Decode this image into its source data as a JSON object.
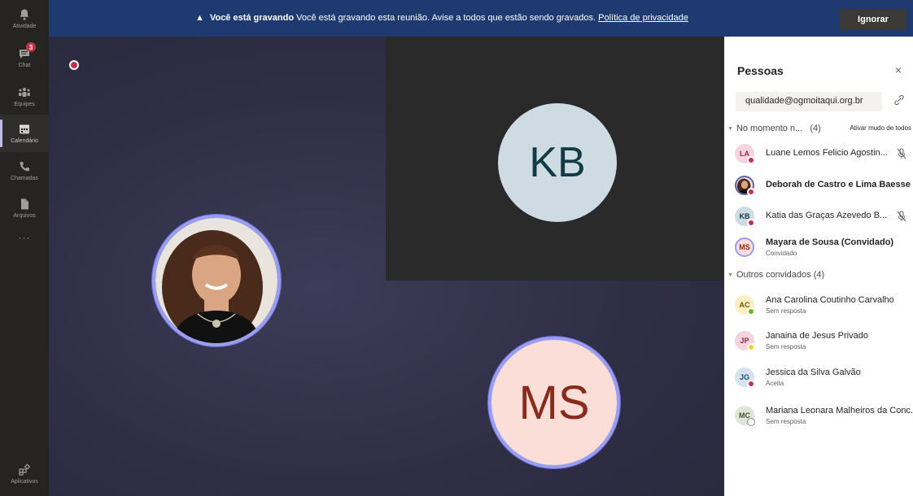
{
  "rail": {
    "items": [
      {
        "label": "Atividade",
        "icon": "bell-icon"
      },
      {
        "label": "Chat",
        "icon": "chat-icon",
        "badge": "3"
      },
      {
        "label": "Equipes",
        "icon": "teams-icon"
      },
      {
        "label": "Calendário",
        "icon": "calendar-icon",
        "active": true
      },
      {
        "label": "Chamadas",
        "icon": "phone-icon"
      },
      {
        "label": "Arquivos",
        "icon": "file-icon"
      },
      {
        "label": "···",
        "icon": "more-icon"
      }
    ],
    "apps_label": "Aplicativos"
  },
  "banner": {
    "title": "Você está gravando",
    "message": "Você está gravando esta reunião. Avise a todos que estão sendo gravados.",
    "link": "Política de privacidade",
    "ignore_label": "Ignorar",
    "color": "#1f3a71"
  },
  "stage": {
    "kb_initials": "KB",
    "ms_initials": "MS"
  },
  "panel": {
    "title": "Pessoas",
    "close": "×",
    "email": "qualidade@ogmoitaqui.org.br",
    "section_current": "No momento n...",
    "section_current_count": "(4)",
    "mute_all": "Ativar mudo de todos",
    "section_others": "Outros convidados (4)",
    "current": [
      {
        "initials": "LA",
        "name": "Luane Lemos Felicio Agostin...",
        "avatar_bg": "#f4d5df",
        "avatar_fg": "#a3294b",
        "status": "#c4314b",
        "muted": true
      },
      {
        "initials": "",
        "name": "Deborah de Castro e Lima Baesse",
        "bold": true,
        "status": "#c4314b",
        "photo": true
      },
      {
        "initials": "KB",
        "name": "Katia das Graças Azevedo B...",
        "avatar_bg": "#cfdbe3",
        "avatar_fg": "#123b45",
        "status": "#c4314b",
        "muted": true
      },
      {
        "initials": "MS",
        "name": "Mayara de Sousa (Convidado)",
        "sub": "Convidado",
        "bold": true,
        "avatar_bg": "#fbded8",
        "avatar_fg": "#8a2a1c"
      }
    ],
    "others": [
      {
        "initials": "AC",
        "name": "Ana Carolina Coutinho Carvalho",
        "sub": "Sem resposta",
        "avatar_bg": "#fcefc4",
        "avatar_fg": "#7a5a00",
        "status": "#6bb700"
      },
      {
        "initials": "JP",
        "name": "Janaina de Jesus Privado",
        "sub": "Sem resposta",
        "avatar_bg": "#f4d5df",
        "avatar_fg": "#a3294b",
        "status": "#f8d22a"
      },
      {
        "initials": "JG",
        "name": "Jessica da Silva Galvão",
        "sub": "Aceita",
        "avatar_bg": "#d5e3ef",
        "avatar_fg": "#1f4e79",
        "status": "#c4314b"
      },
      {
        "initials": "MC",
        "name": "Mariana Leonara Malheiros da Conc...",
        "sub": "Sem resposta",
        "avatar_bg": "#dfe5d7",
        "avatar_fg": "#45583a",
        "status": "#ffffff",
        "status_ring": "#8a8886"
      }
    ]
  }
}
